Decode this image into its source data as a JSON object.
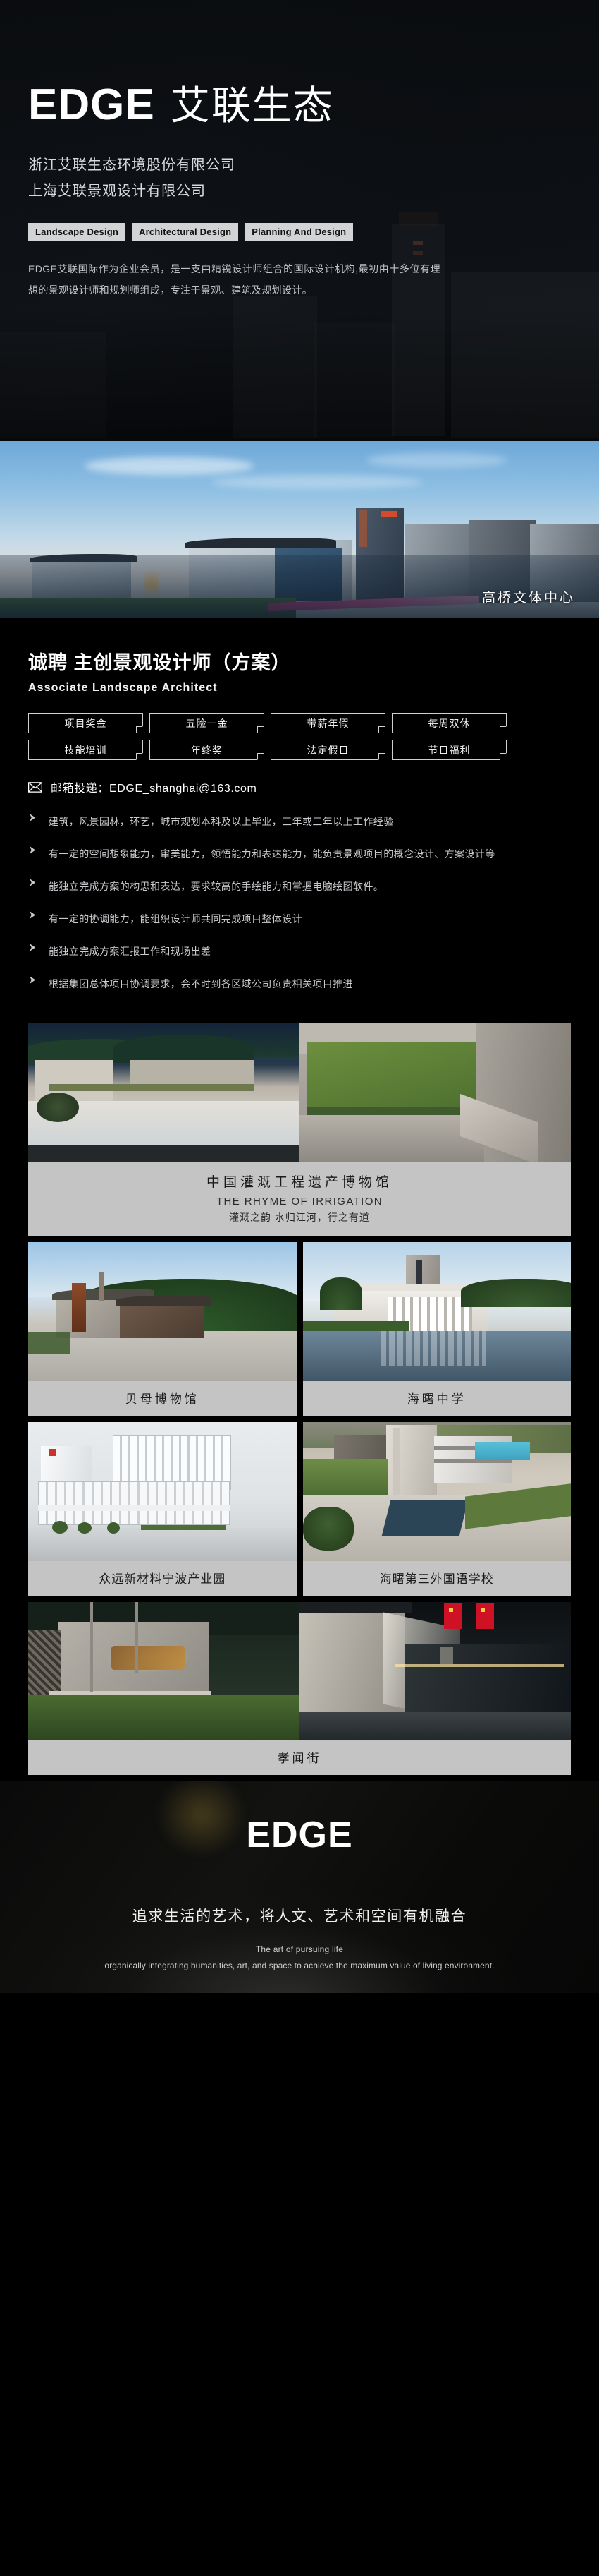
{
  "masthead": {
    "brand_en": "EDGE",
    "brand_cn": "艾联生态",
    "company_lines": [
      "浙江艾联生态环境股份有限公司",
      "上海艾联景观设计有限公司"
    ],
    "tags": [
      "Landscape Design",
      "Architectural Design",
      "Planning And Design"
    ],
    "intro": "EDGE艾联国际作为企业会员，是一支由精锐设计师组合的国际设计机构,最初由十多位有理想的景观设计师和规划师组成，专注于景观、建筑及规划设计。"
  },
  "hero": {
    "caption": "高桥文体中心"
  },
  "recruit": {
    "title": "诚聘  主创景观设计师（方案）",
    "subtitle": "Associate Landscape Architect",
    "perks": [
      "项目奖金",
      "五险一金",
      "带薪年假",
      "每周双休",
      "技能培训",
      "年终奖",
      "法定假日",
      "节日福利"
    ],
    "mail_label": "邮箱投递：EDGE_shanghai@163.com",
    "mail_icon": "envelope-icon",
    "bullet_icon": "arrow-right-icon",
    "requirements": [
      "建筑，风景园林，环艺，城市规划本科及以上毕业，三年或三年以上工作经验",
      "有一定的空间想象能力，审美能力，领悟能力和表达能力，能负责景观项目的概念设计、方案设计等",
      "能独立完成方案的构思和表达，要求较高的手绘能力和掌握电脑绘图软件。",
      "有一定的协调能力，能组织设计师共同完成项目整体设计",
      "能独立完成方案汇报工作和现场出差",
      "根据集团总体项目协调要求，会不时到各区域公司负责相关项目推进"
    ]
  },
  "gallery": {
    "feature": {
      "title": "中国灌溉工程遗产博物馆",
      "subtitle_en": "THE RHYME OF IRRIGATION",
      "subtitle_cn": "灌溉之韵 水归江河，行之有道"
    },
    "rows": [
      [
        {
          "title": "贝母博物馆"
        },
        {
          "title": "海曙中学"
        }
      ],
      [
        {
          "title": "众远新材料宁波产业园"
        },
        {
          "title": "海曙第三外国语学校"
        }
      ]
    ],
    "last": {
      "title": "孝闻街"
    }
  },
  "footer": {
    "logo": "EDGE",
    "slogan_cn": "追求生活的艺术，将人文、艺术和空间有机融合",
    "slogan_en_1": "The art of pursuing life",
    "slogan_en_2": "organically integrating humanities, art, and space to achieve the maximum value of living environment."
  },
  "colors": {
    "background": "#000000",
    "card_panel": "#c4c4c4",
    "tag_chip": "#d2d3d4",
    "text_primary": "#ffffff",
    "text_muted": "#c9cbce"
  }
}
